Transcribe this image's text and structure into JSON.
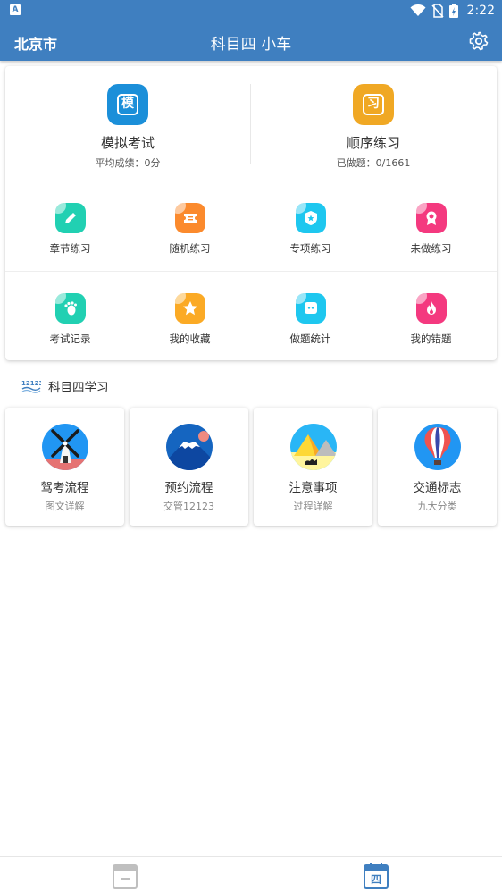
{
  "status_bar": {
    "notification_icon": "A",
    "time": "2:22"
  },
  "app_bar": {
    "city": "北京市",
    "title": "科目四 小车",
    "settings_icon": "gear-icon"
  },
  "main_actions": [
    {
      "label": "模拟考试",
      "sub": "平均成绩：0分",
      "glyph": "模",
      "color": "#1b8fd9"
    },
    {
      "label": "顺序练习",
      "sub": "已做题：0/1661",
      "glyph": "习",
      "color": "#f0a824"
    }
  ],
  "grid_rows": [
    [
      {
        "label": "章节练习",
        "icon": "pencil-icon",
        "color": "#21d0b2"
      },
      {
        "label": "随机练习",
        "icon": "ticket-icon",
        "color": "#fb8a2d"
      },
      {
        "label": "专项练习",
        "icon": "shield-star-icon",
        "color": "#1ec7ef"
      },
      {
        "label": "未做练习",
        "icon": "ribbon-icon",
        "color": "#f4397f"
      }
    ],
    [
      {
        "label": "考试记录",
        "icon": "footprint-icon",
        "color": "#21d0b2"
      },
      {
        "label": "我的收藏",
        "icon": "star-icon",
        "color": "#fbaa25"
      },
      {
        "label": "做题统计",
        "icon": "chat-icon",
        "color": "#1ec7ef"
      },
      {
        "label": "我的错题",
        "icon": "flame-icon",
        "color": "#f4397f"
      }
    ]
  ],
  "study_section": {
    "logo_text": "12123",
    "title": "科目四学习"
  },
  "study_cards": [
    {
      "title": "驾考流程",
      "sub": "图文详解",
      "icon": "windmill-icon"
    },
    {
      "title": "预约流程",
      "sub": "交管12123",
      "icon": "mountain-icon"
    },
    {
      "title": "注意事项",
      "sub": "过程详解",
      "icon": "pyramid-icon"
    },
    {
      "title": "交通标志",
      "sub": "九大分类",
      "icon": "balloon-icon"
    }
  ],
  "bottom_tabs": [
    {
      "icon": "calendar-blank-icon",
      "color": "#bfbfbf"
    },
    {
      "icon": "calendar-four-icon",
      "label": "四",
      "color": "#3f7fc0"
    }
  ]
}
